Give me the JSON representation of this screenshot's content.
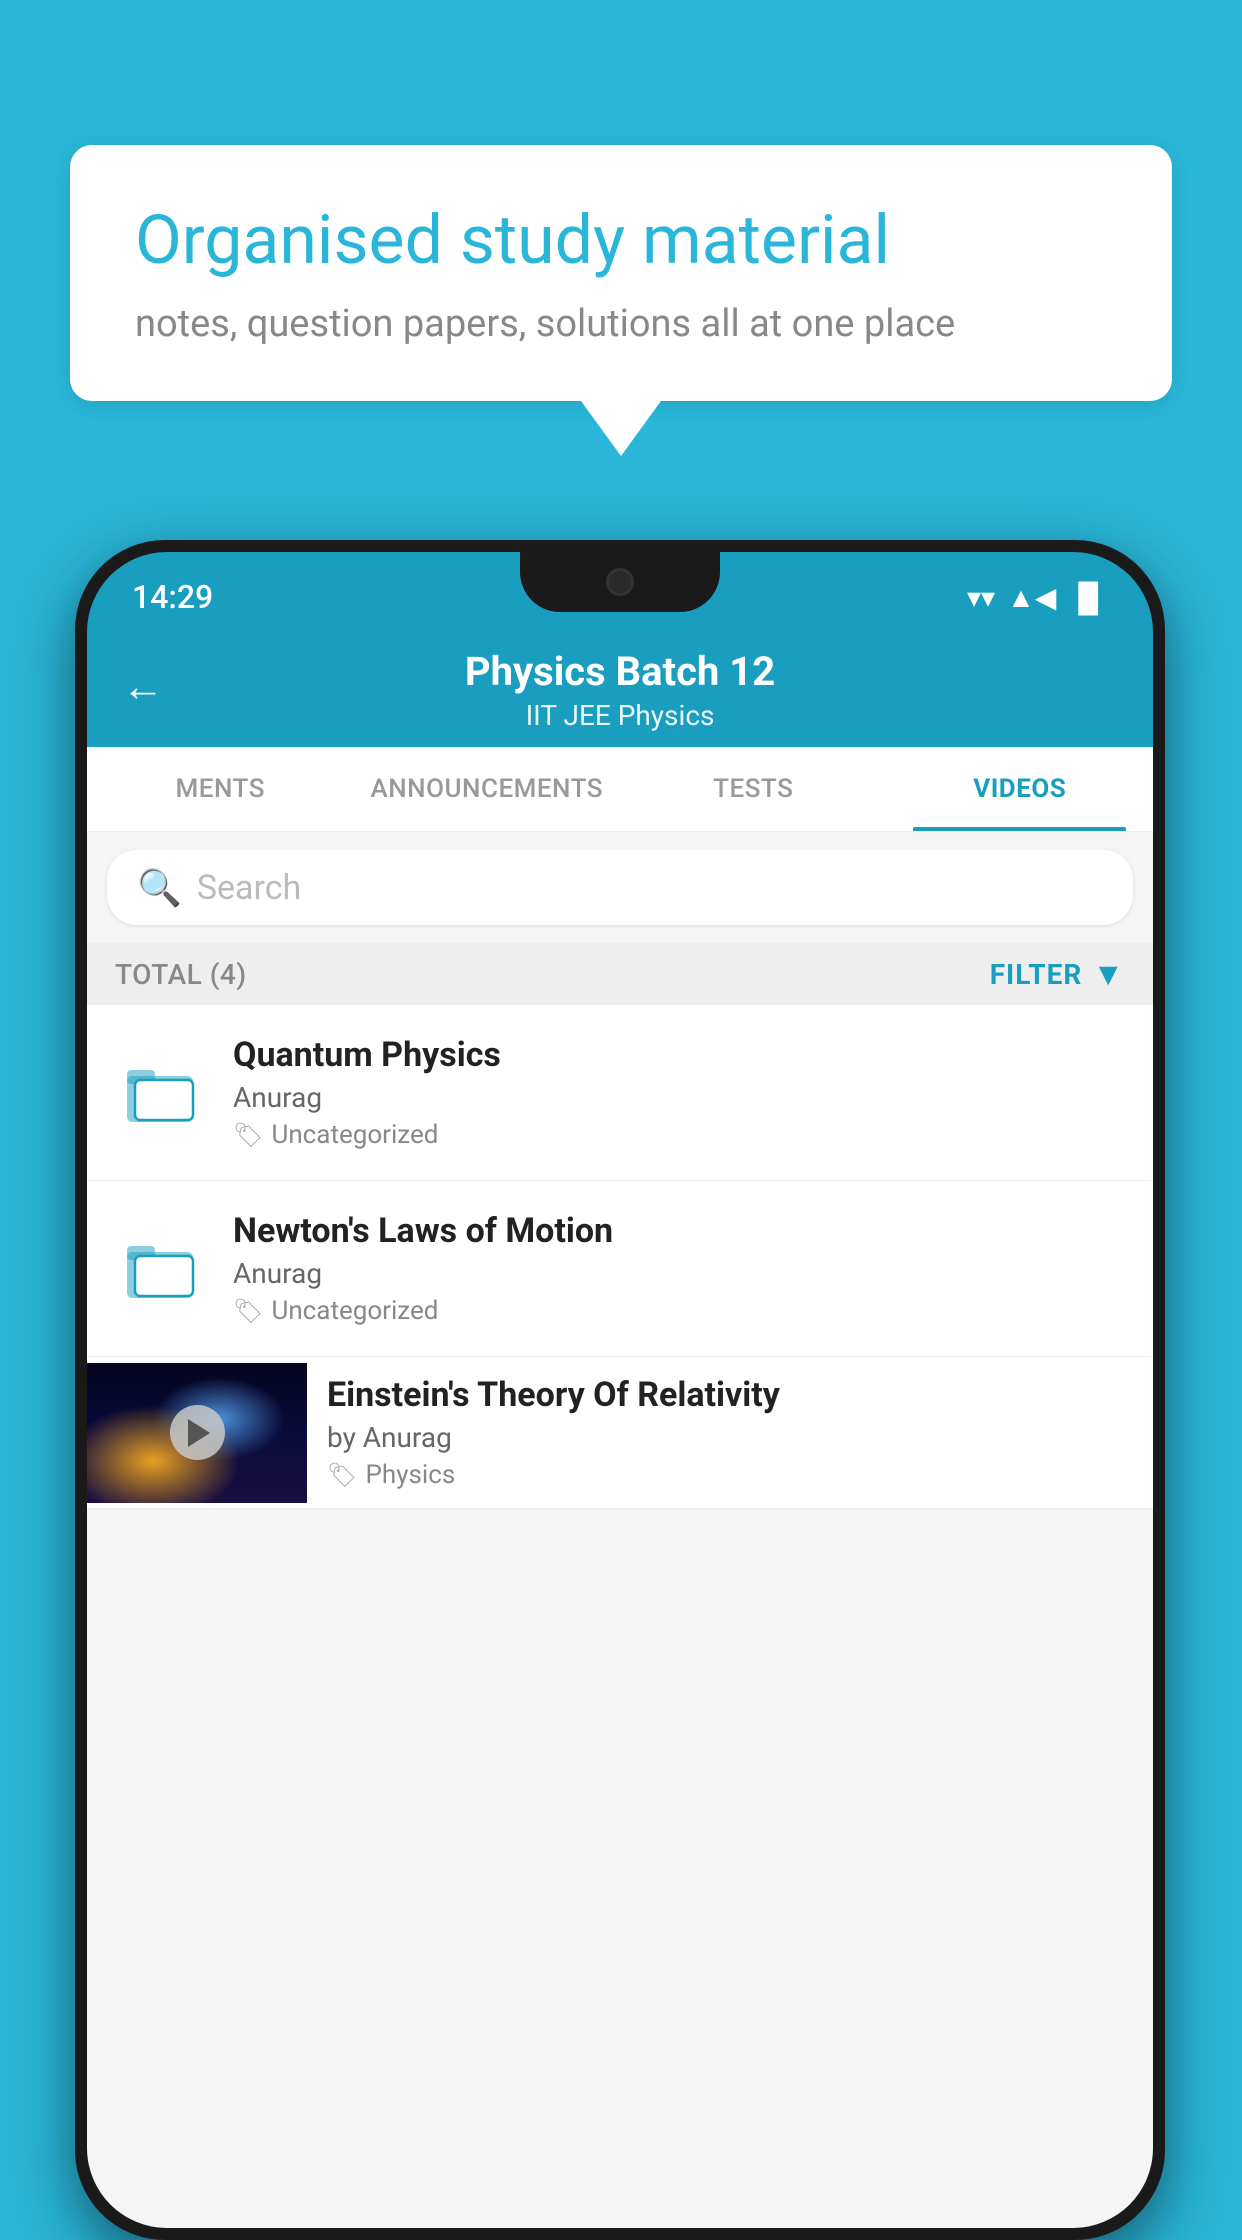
{
  "background_color": "#29b6d8",
  "speech_bubble": {
    "title": "Organised study material",
    "subtitle": "notes, question papers, solutions all at one place"
  },
  "status_bar": {
    "time": "14:29",
    "wifi": "▼",
    "signal": "▲",
    "battery": "▐"
  },
  "header": {
    "title": "Physics Batch 12",
    "subtitle": "IIT JEE   Physics",
    "back_label": "←"
  },
  "tabs": [
    {
      "label": "MENTS",
      "active": false
    },
    {
      "label": "ANNOUNCEMENTS",
      "active": false
    },
    {
      "label": "TESTS",
      "active": false
    },
    {
      "label": "VIDEOS",
      "active": true
    }
  ],
  "search": {
    "placeholder": "Search"
  },
  "filter_row": {
    "total_label": "TOTAL (4)",
    "filter_label": "FILTER"
  },
  "list_items": [
    {
      "title": "Quantum Physics",
      "author": "Anurag",
      "tag": "Uncategorized",
      "type": "folder"
    },
    {
      "title": "Newton's Laws of Motion",
      "author": "Anurag",
      "tag": "Uncategorized",
      "type": "folder"
    },
    {
      "title": "Einstein's Theory Of Relativity",
      "author": "by Anurag",
      "tag": "Physics",
      "type": "video"
    }
  ]
}
